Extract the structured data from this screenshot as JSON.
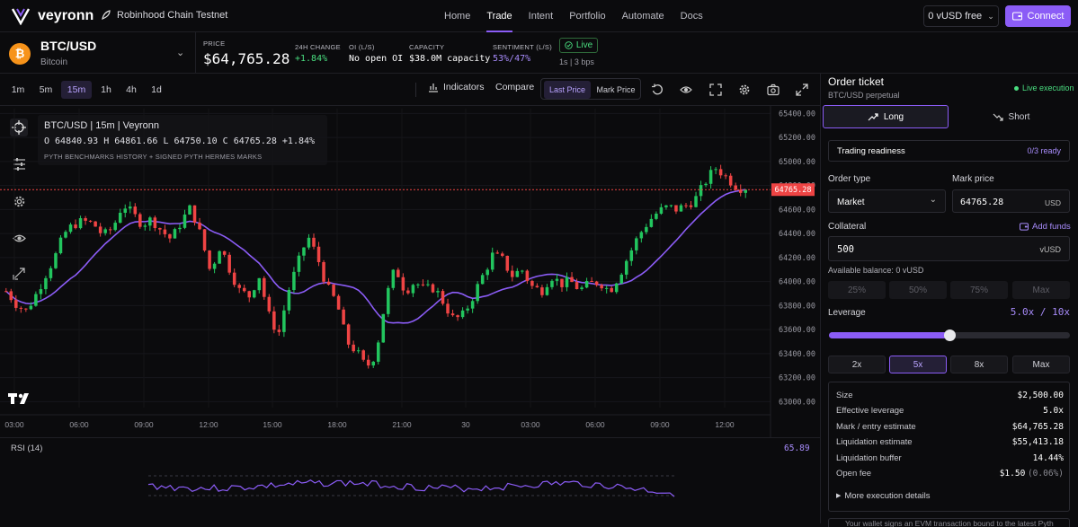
{
  "app": {
    "brand": "veyronn",
    "chain": "Robinhood Chain Testnet"
  },
  "nav": {
    "links": [
      "Home",
      "Trade",
      "Intent",
      "Portfolio",
      "Automate",
      "Docs"
    ],
    "active": "Trade"
  },
  "wallet": {
    "balance": "0 vUSD free",
    "connect_label": "Connect"
  },
  "market": {
    "symbol": "BTC/USD",
    "name": "Bitcoin",
    "price_label": "PRICE",
    "price": "$64,765.28",
    "change_label": "24H CHANGE",
    "change": "+1.84%",
    "oi_label": "OI (L/S)",
    "oi": "No open OI",
    "capacity_label": "CAPACITY",
    "capacity": "$38.0M capacity",
    "sentiment_label": "SENTIMENT (L/S)",
    "sentiment": "53%/47%",
    "status": "Live",
    "latency": "1s | 3 bps"
  },
  "toolbar": {
    "intervals": [
      "1m",
      "5m",
      "15m",
      "1h",
      "4h",
      "1d"
    ],
    "active_interval": "15m",
    "indicators": "Indicators",
    "compare": "Compare",
    "price_modes": [
      "Last Price",
      "Mark Price"
    ],
    "active_price_mode": "Last Price"
  },
  "legend": {
    "title": "BTC/USD | 15m | Veyronn",
    "ohlc": "O 64840.93 H 64861.66 L 64750.10 C 64765.28 +1.84%",
    "source": "PYTH BENCHMARKS HISTORY + SIGNED PYTH HERMES MARKS"
  },
  "chart_data": {
    "type": "candlestick",
    "y_ticks": [
      65400,
      65200,
      65000,
      64800,
      64600,
      64400,
      64200,
      64000,
      63800,
      63600,
      63400,
      63200,
      63000
    ],
    "y_tick_labels": [
      "65400.00",
      "65200.00",
      "65000.00",
      "64800.00",
      "64600.00",
      "64400.00",
      "64200.00",
      "64000.00",
      "63800.00",
      "63600.00",
      "63400.00",
      "63200.00",
      "63000.00"
    ],
    "ylim": [
      62950,
      65440
    ],
    "x_tick_labels": [
      "03:00",
      "06:00",
      "09:00",
      "12:00",
      "15:00",
      "18:00",
      "21:00",
      "30",
      "03:00",
      "06:00",
      "09:00",
      "12:00"
    ],
    "last_price": 64765.28,
    "last_price_label": "64765.28",
    "grid": true,
    "close_path": [
      63920,
      63820,
      63750,
      63880,
      64050,
      64200,
      64400,
      64480,
      64500,
      64480,
      64380,
      64450,
      64650,
      64560,
      64480,
      64520,
      64420,
      64350,
      64500,
      64620,
      64380,
      64080,
      64300,
      64100,
      63920,
      63880,
      64050,
      63720,
      63560,
      63920,
      64150,
      64380,
      64200,
      63950,
      63820,
      63500,
      63420,
      63280,
      63400,
      63850,
      64120,
      63920,
      64000,
      63930,
      63950,
      63820,
      63680,
      63720,
      63880,
      64050,
      64220,
      64180,
      64050,
      64100,
      63960,
      63920,
      64050,
      63980,
      64000,
      63930,
      63980,
      64000,
      63920,
      64050,
      64220,
      64380,
      64500,
      64580,
      64620,
      64600,
      64640,
      64700,
      64850,
      64950,
      64870,
      64800,
      64765
    ],
    "series": [
      {
        "name": "Price",
        "color": "#22c55e"
      },
      {
        "name": "MA",
        "color": "#8b5cf6"
      }
    ]
  },
  "rsi": {
    "label": "RSI (14)",
    "value": "65.89",
    "color": "#8b5cf6"
  },
  "ticket": {
    "title": "Order ticket",
    "subtitle": "BTC/USD perpetual",
    "live": "Live execution",
    "long": "Long",
    "short": "Short",
    "readiness": "Trading readiness",
    "readiness_value": "0/3 ready",
    "order_type_label": "Order type",
    "order_type": "Market",
    "mark_price_label": "Mark price",
    "mark_price": "64765.28",
    "mark_unit": "USD",
    "collateral_label": "Collateral",
    "add_funds": "Add funds",
    "collateral": "500",
    "collateral_unit": "vUSD",
    "available": "Available balance: 0 vUSD",
    "pct_options": [
      "25%",
      "50%",
      "75%",
      "Max"
    ],
    "leverage_label": "Leverage",
    "leverage_value": "5.0x / 10x",
    "leverage_fraction": 0.5,
    "leverage_options": [
      "2x",
      "5x",
      "8x",
      "Max"
    ],
    "leverage_selected": "5x",
    "summary": [
      {
        "label": "Size",
        "value": "$2,500.00"
      },
      {
        "label": "Effective leverage",
        "value": "5.0x"
      },
      {
        "label": "Mark / entry estimate",
        "value": "$64,765.28"
      },
      {
        "label": "Liquidation estimate",
        "value": "$55,413.18"
      },
      {
        "label": "Liquidation buffer",
        "value": "14.44%"
      },
      {
        "label": "Open fee",
        "value": "$1.50",
        "sub": "(0.06%)"
      }
    ],
    "more": "More execution details",
    "footnote": "Your wallet signs an EVM transaction bound to the latest Pyth"
  },
  "colors": {
    "accent": "#8b5cf6",
    "up": "#22c55e",
    "down": "#ef4444",
    "bg": "#0b0b0d"
  }
}
